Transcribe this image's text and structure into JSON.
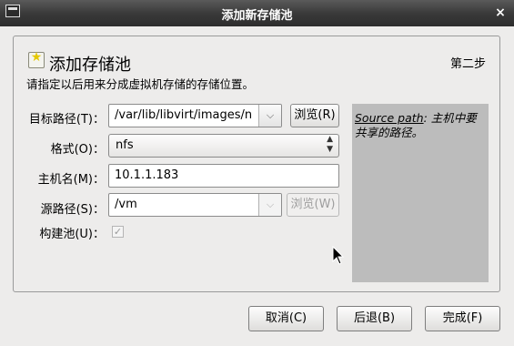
{
  "window": {
    "title": "添加新存储池",
    "close_glyph": "×"
  },
  "header": {
    "title": "添加存储池",
    "step": "第二步",
    "description": "请指定以后用来分成虚拟机存储的存储位置。"
  },
  "form": {
    "target_path": {
      "label": "目标路径(T)：",
      "value": "/var/lib/libvirt/images/n",
      "browse_label": "浏览(R)"
    },
    "format": {
      "label": "格式(O)：",
      "value": "nfs"
    },
    "hostname": {
      "label": "主机名(M)：",
      "value": "10.1.1.183"
    },
    "source_path": {
      "label": "源路径(S)：",
      "value": "/vm",
      "browse_label": "浏览(W)"
    },
    "build_pool": {
      "label": "构建池(U)：",
      "checked": true,
      "enabled": false
    }
  },
  "help": {
    "link": "Source path",
    "text_inline": ": 主机中要",
    "text_rest": "共享的路径。"
  },
  "buttons": {
    "cancel": "取消(C)",
    "back": "后退(B)",
    "finish": "完成(F)"
  },
  "icons": {
    "window_menu": "window-menu-icon",
    "header": "storage-pool-icon",
    "cursor": "mouse-pointer-icon"
  }
}
